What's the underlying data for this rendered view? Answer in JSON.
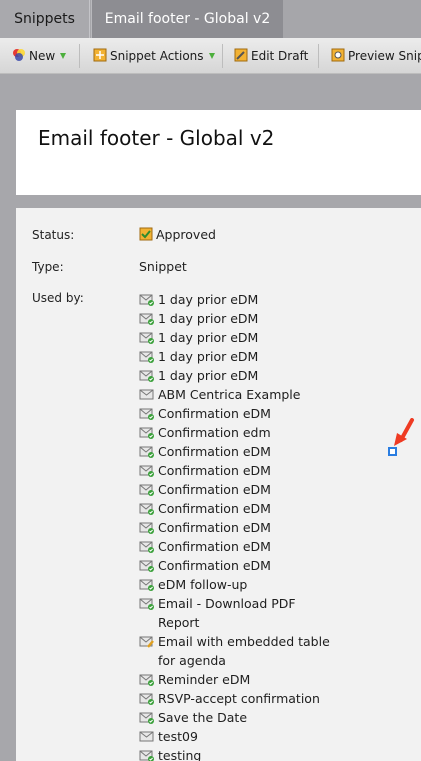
{
  "tabs": [
    {
      "label": "Snippets"
    },
    {
      "label": "Email footer - Global v2"
    }
  ],
  "toolbar": {
    "new_label": "New",
    "snippet_actions_label": "Snippet Actions",
    "edit_draft_label": "Edit Draft",
    "preview_label": "Preview Snipp"
  },
  "page_title": "Email footer - Global v2",
  "details": {
    "status_label": "Status:",
    "status_value": "Approved",
    "type_label": "Type:",
    "type_value": "Snippet",
    "used_by_label": "Used by:"
  },
  "used_by": [
    {
      "line1": "1 day prior eDM",
      "icon": "approved-email-icon"
    },
    {
      "line1": "1 day prior eDM",
      "icon": "approved-email-icon"
    },
    {
      "line1": "1 day prior eDM",
      "icon": "approved-email-icon"
    },
    {
      "line1": "1 day prior eDM",
      "icon": "approved-email-icon"
    },
    {
      "line1": "1 day prior eDM",
      "icon": "approved-email-icon"
    },
    {
      "line1": "ABM Centrica Example",
      "icon": "draft-email-icon"
    },
    {
      "line1": "Confirmation eDM",
      "icon": "approved-email-icon"
    },
    {
      "line1": "Confirmation edm",
      "icon": "approved-email-icon"
    },
    {
      "line1": "Confirmation eDM",
      "icon": "approved-email-icon"
    },
    {
      "line1": "Confirmation eDM",
      "icon": "approved-email-icon"
    },
    {
      "line1": "Confirmation eDM",
      "icon": "approved-email-icon"
    },
    {
      "line1": "Confirmation eDM",
      "icon": "approved-email-icon"
    },
    {
      "line1": "Confirmation eDM",
      "icon": "approved-email-icon"
    },
    {
      "line1": "Confirmation eDM",
      "icon": "approved-email-icon"
    },
    {
      "line1": "Confirmation eDM",
      "icon": "approved-email-icon"
    },
    {
      "line1": "eDM follow-up",
      "icon": "approved-email-icon"
    },
    {
      "line1": "Email - Download PDF",
      "line2": "Report",
      "icon": "approved-email-icon"
    },
    {
      "line1": "Email with embedded table",
      "line2": "for agenda",
      "icon": "edited-email-icon"
    },
    {
      "line1": "Reminder eDM",
      "icon": "approved-email-icon"
    },
    {
      "line1": "RSVP-accept confirmation",
      "icon": "approved-email-icon"
    },
    {
      "line1": "Save the Date",
      "icon": "approved-email-icon"
    },
    {
      "line1": "test09",
      "icon": "draft-email-icon"
    },
    {
      "line1": "testing",
      "icon": "approved-email-icon"
    }
  ]
}
